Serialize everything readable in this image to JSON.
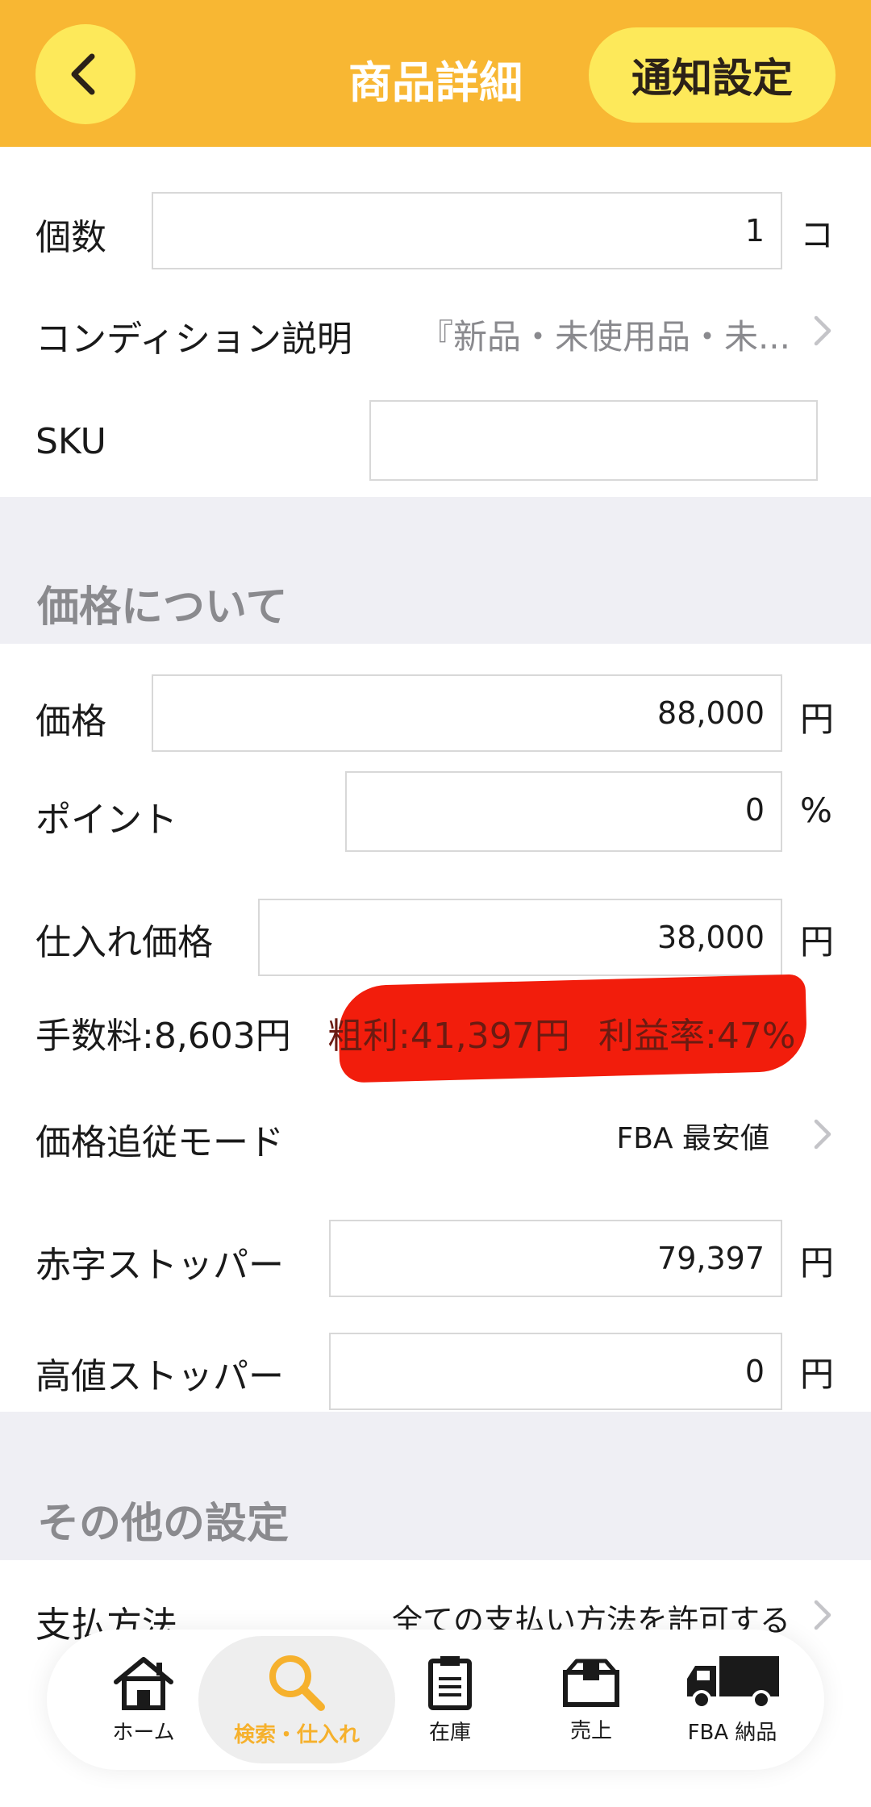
{
  "header": {
    "title": "商品詳細",
    "notify_label": "通知設定"
  },
  "quantity": {
    "label": "個数",
    "value": "1",
    "unit": "コ"
  },
  "condition": {
    "label": "コンディション説明",
    "value": "『新品・未使用品・未..."
  },
  "sku": {
    "label": "SKU",
    "value": ""
  },
  "price_section": {
    "title": "価格について"
  },
  "price": {
    "label": "価格",
    "value": "88,000",
    "unit": "円"
  },
  "point": {
    "label": "ポイント",
    "value": "0",
    "unit": "%"
  },
  "purchase_price": {
    "label": "仕入れ価格",
    "value": "38,000",
    "unit": "円"
  },
  "summary": {
    "fee": "手数料:8,603円",
    "gross_profit": "粗利:41,397円",
    "profit_rate": "利益率:47%"
  },
  "tracking_mode": {
    "label": "価格追従モード",
    "value": "FBA 最安値"
  },
  "loss_stopper": {
    "label": "赤字ストッパー",
    "value": "79,397",
    "unit": "円"
  },
  "high_stopper": {
    "label": "高値ストッパー",
    "value": "0",
    "unit": "円"
  },
  "other_section": {
    "title": "その他の設定"
  },
  "payment": {
    "label": "支払方法",
    "value": "全ての支払い方法を許可する"
  },
  "nav": {
    "items": [
      {
        "label": "ホーム",
        "icon": "home-icon"
      },
      {
        "label": "検索・仕入れ",
        "icon": "search-icon",
        "active": true
      },
      {
        "label": "在庫",
        "icon": "clipboard-icon"
      },
      {
        "label": "売上",
        "icon": "box-icon"
      },
      {
        "label": "FBA 納品",
        "icon": "truck-icon"
      }
    ]
  },
  "colors": {
    "header": "#f8b733",
    "button": "#fde95a",
    "active_nav": "#f6b12d",
    "section_bg": "#efeff4",
    "redaction": "#f21d0c"
  }
}
